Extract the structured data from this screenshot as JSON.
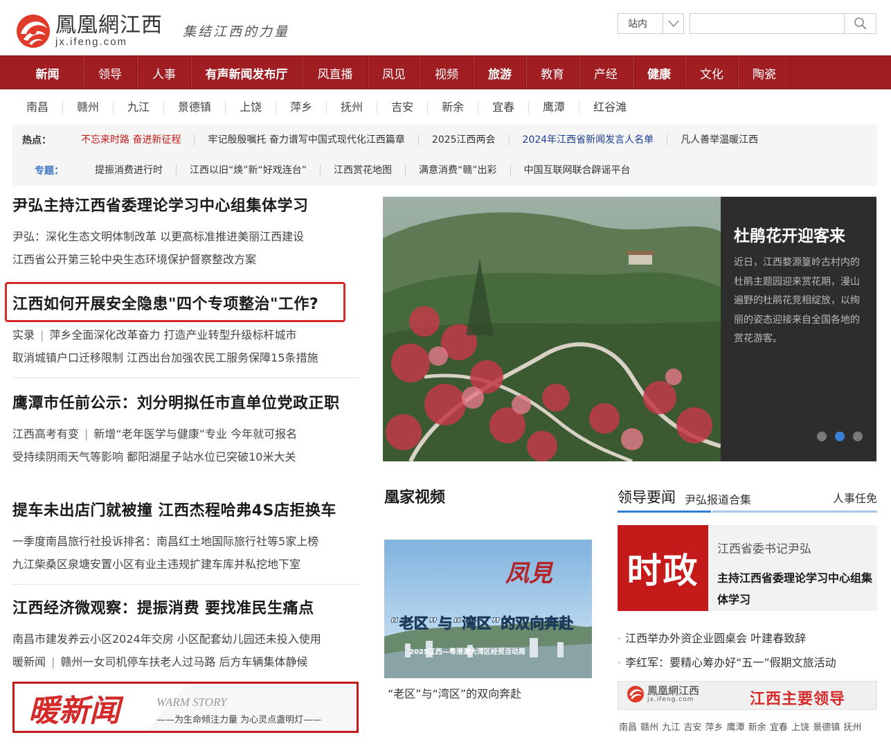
{
  "header": {
    "logo_cn": "鳳凰網江西",
    "logo_en": "jx.ifeng.com",
    "slogan": "集结江西的力量",
    "search_scope": "站内",
    "search_placeholder": ""
  },
  "mainnav": [
    {
      "label": "新闻",
      "bold": true
    },
    {
      "label": "领导",
      "bold": false
    },
    {
      "label": "人事",
      "bold": false
    },
    {
      "label": "有声新闻发布厅",
      "bold": true
    },
    {
      "label": "风直播",
      "bold": false
    },
    {
      "label": "凤见",
      "bold": false
    },
    {
      "label": "视频",
      "bold": false
    },
    {
      "label": "旅游",
      "bold": true
    },
    {
      "label": "教育",
      "bold": false
    },
    {
      "label": "产经",
      "bold": false
    },
    {
      "label": "健康",
      "bold": true
    },
    {
      "label": "文化",
      "bold": false
    },
    {
      "label": "陶瓷",
      "bold": false
    }
  ],
  "citynav": [
    "南昌",
    "赣州",
    "九江",
    "景德镇",
    "上饶",
    "萍乡",
    "抚州",
    "吉安",
    "新余",
    "宜春",
    "鹰潭",
    "红谷滩"
  ],
  "hotbar": {
    "hot_label": "热点：",
    "hot_links": [
      {
        "text": "不忘来时路  奋进新征程",
        "style": "red"
      },
      {
        "text": "牢记殷殷嘱托  奋力谱写中国式现代化江西篇章",
        "style": ""
      },
      {
        "text": "2025江西两会",
        "style": ""
      },
      {
        "text": "2024年江西省新闻发言人名单",
        "style": "blue"
      },
      {
        "text": "凡人善举温暖江西",
        "style": ""
      }
    ],
    "topic_label": "专题：",
    "topic_links": [
      "提振消费进行时",
      "江西以旧“焕”新“好戏连台”",
      "江西赏花地图",
      "满意消费“赣”出彩",
      "中国互联网联合辟谣平台"
    ]
  },
  "news": [
    {
      "headline": "尹弘主持江西省委理论学习中心组集体学习",
      "subs": [
        [
          "尹弘：深化生态文明体制改革 以更高标准推进美丽江西建设"
        ],
        [
          "江西省公开第三轮中央生态环境保护督察整改方案"
        ]
      ]
    },
    {
      "headline": "江西如何开展安全隐患\"四个专项整治\"工作?",
      "subs": [
        [
          "实录",
          "萍乡全面深化改革奋力 打造产业转型升级标杆城市"
        ],
        [
          "取消城镇户口迁移限制 江西出台加强农民工服务保障15条措施"
        ]
      ]
    },
    {
      "headline": "鹰潭市任前公示：刘分明拟任市直单位党政正职",
      "subs": [
        [
          "江西高考有变",
          "新增“老年医学与健康”专业 今年就可报名"
        ],
        [
          "受持续阴雨天气等影响 鄱阳湖星子站水位已突破10米大关"
        ]
      ]
    },
    {
      "headline": "提车未出店门就被撞 江西杰程哈弗4S店拒换车",
      "subs": [
        [
          "一季度南昌旅行社投诉排名：南昌红土地国际旅行社等5家上榜"
        ],
        [
          "九江柴桑区泉塘安置小区有业主违规扩建车库并私挖地下室"
        ]
      ]
    },
    {
      "headline": "江西经济微观察：提振消费 要找准民生痛点",
      "subs": [
        [
          "南昌市建发养云小区2024年交房 小区配套幼儿园还未投入使用"
        ],
        [
          "暖新闻",
          "赣州一女司机停车扶老人过马路 后方车辆集体静候"
        ]
      ]
    }
  ],
  "warm_banner": {
    "title": "暖新闻",
    "en": "WARM STORY",
    "tagline": "——为生命倾注力量 为心灵点盏明灯——"
  },
  "slider": {
    "title": "杜鹃花开迎客来",
    "desc": "近日，江西婺源篁岭古村内的杜鹃主题园迎来赏花期，漫山遍野的杜鹃花竞相绽放，以绚丽的姿态迎接来自全国各地的赏花游客。",
    "active_index": 1,
    "count": 3
  },
  "video": {
    "section_title": "凰家视频",
    "thumb_brand": "凤見",
    "thumb_big": "“老区”与“湾区”的双向奔赴",
    "thumb_sub": "2025江西—粤港澳大湾区经贸活动周",
    "caption": "“老区”与“湾区”的双向奔赴"
  },
  "leader": {
    "tab_main": "领导要闻",
    "tab_sub": "尹弘报道合集",
    "tab_right": "人事任免",
    "card_badge": "时政",
    "card_line1": "江西省委书记尹弘",
    "card_line2": "主持江西省委理论学习中心组集体学习",
    "list": [
      "江西举办外资企业圆桌会 叶建春致辞",
      "李红军：要精心筹办好“五一”假期文旅活动"
    ],
    "banner_logo_cn": "鳳凰網江西",
    "banner_logo_en": "jx.ifeng.com",
    "banner_title": "江西主要领导",
    "cities_line": "南昌 赣州 九江 吉安 萍乡 鹰潭 新余 宜春 上饶 景德镇 抚州"
  },
  "colors": {
    "brand_red": "#a01d22",
    "accent_blue": "#2e7ad4",
    "highlight_red": "#d42a2a"
  }
}
